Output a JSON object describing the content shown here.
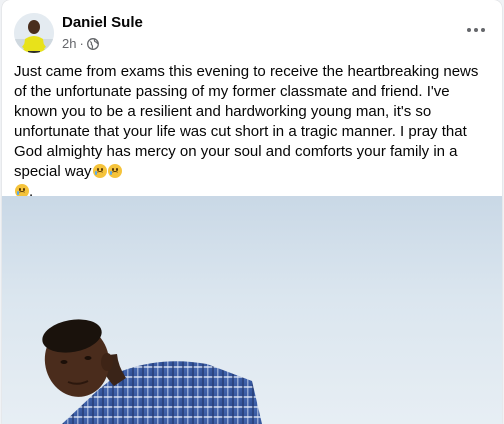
{
  "post": {
    "author": "Daniel Sule",
    "time": "2h",
    "separator": "·",
    "audience_icon": "globe-icon",
    "more_icon": "more-options-icon",
    "text_main": "Just came from exams this evening to receive the heartbreaking news of the unfortunate passing of my former classmate and friend. I've known you to be a resilient and hardworking young man, it's so unfortunate that your life was cut short in a tragic manner. I pray that God almighty has mercy on your soul and comforts your family in a special way",
    "text_end": ".",
    "emoji_icon": "sad-crying-face-emoji"
  },
  "colors": {
    "card_bg": "#ffffff",
    "page_bg": "#f0f2f5",
    "secondary_text": "#65676b",
    "emoji_yellow": "#f5c33b"
  }
}
